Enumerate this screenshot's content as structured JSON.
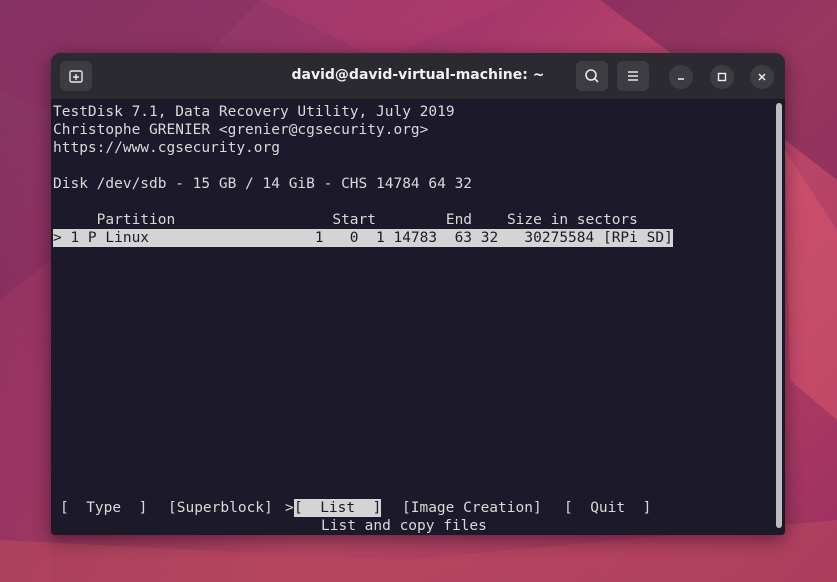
{
  "window": {
    "title": "david@david-virtual-machine: ~",
    "new_tab_icon": "new-tab-icon",
    "search_icon": "search-icon",
    "menu_icon": "hamburger-menu-icon"
  },
  "terminal": {
    "header_lines": [
      "TestDisk 7.1, Data Recovery Utility, July 2019",
      "Christophe GRENIER <grenier@cgsecurity.org>",
      "https://www.cgsecurity.org"
    ],
    "disk_line": "Disk /dev/sdb - 15 GB / 14 GiB - CHS 14784 64 32",
    "columns_line": "     Partition                  Start        End    Size in sectors",
    "partition_row": "> 1 P Linux                   1   0  1 14783  63 32   30275584 [RPi SD]",
    "menu": {
      "type": "[  Type  ]",
      "superblock": "[Superblock]",
      "list_prefix": ">",
      "list": "[  List  ]",
      "image_creation": "[Image Creation]",
      "quit": "[  Quit  ]"
    },
    "hint": "List and copy files"
  },
  "colors": {
    "terminal_bg": "#1c1a2a",
    "terminal_fg": "#d9d9d9",
    "highlight_bg": "#d4d4d4",
    "titlebar_bg": "#2b2a30"
  }
}
